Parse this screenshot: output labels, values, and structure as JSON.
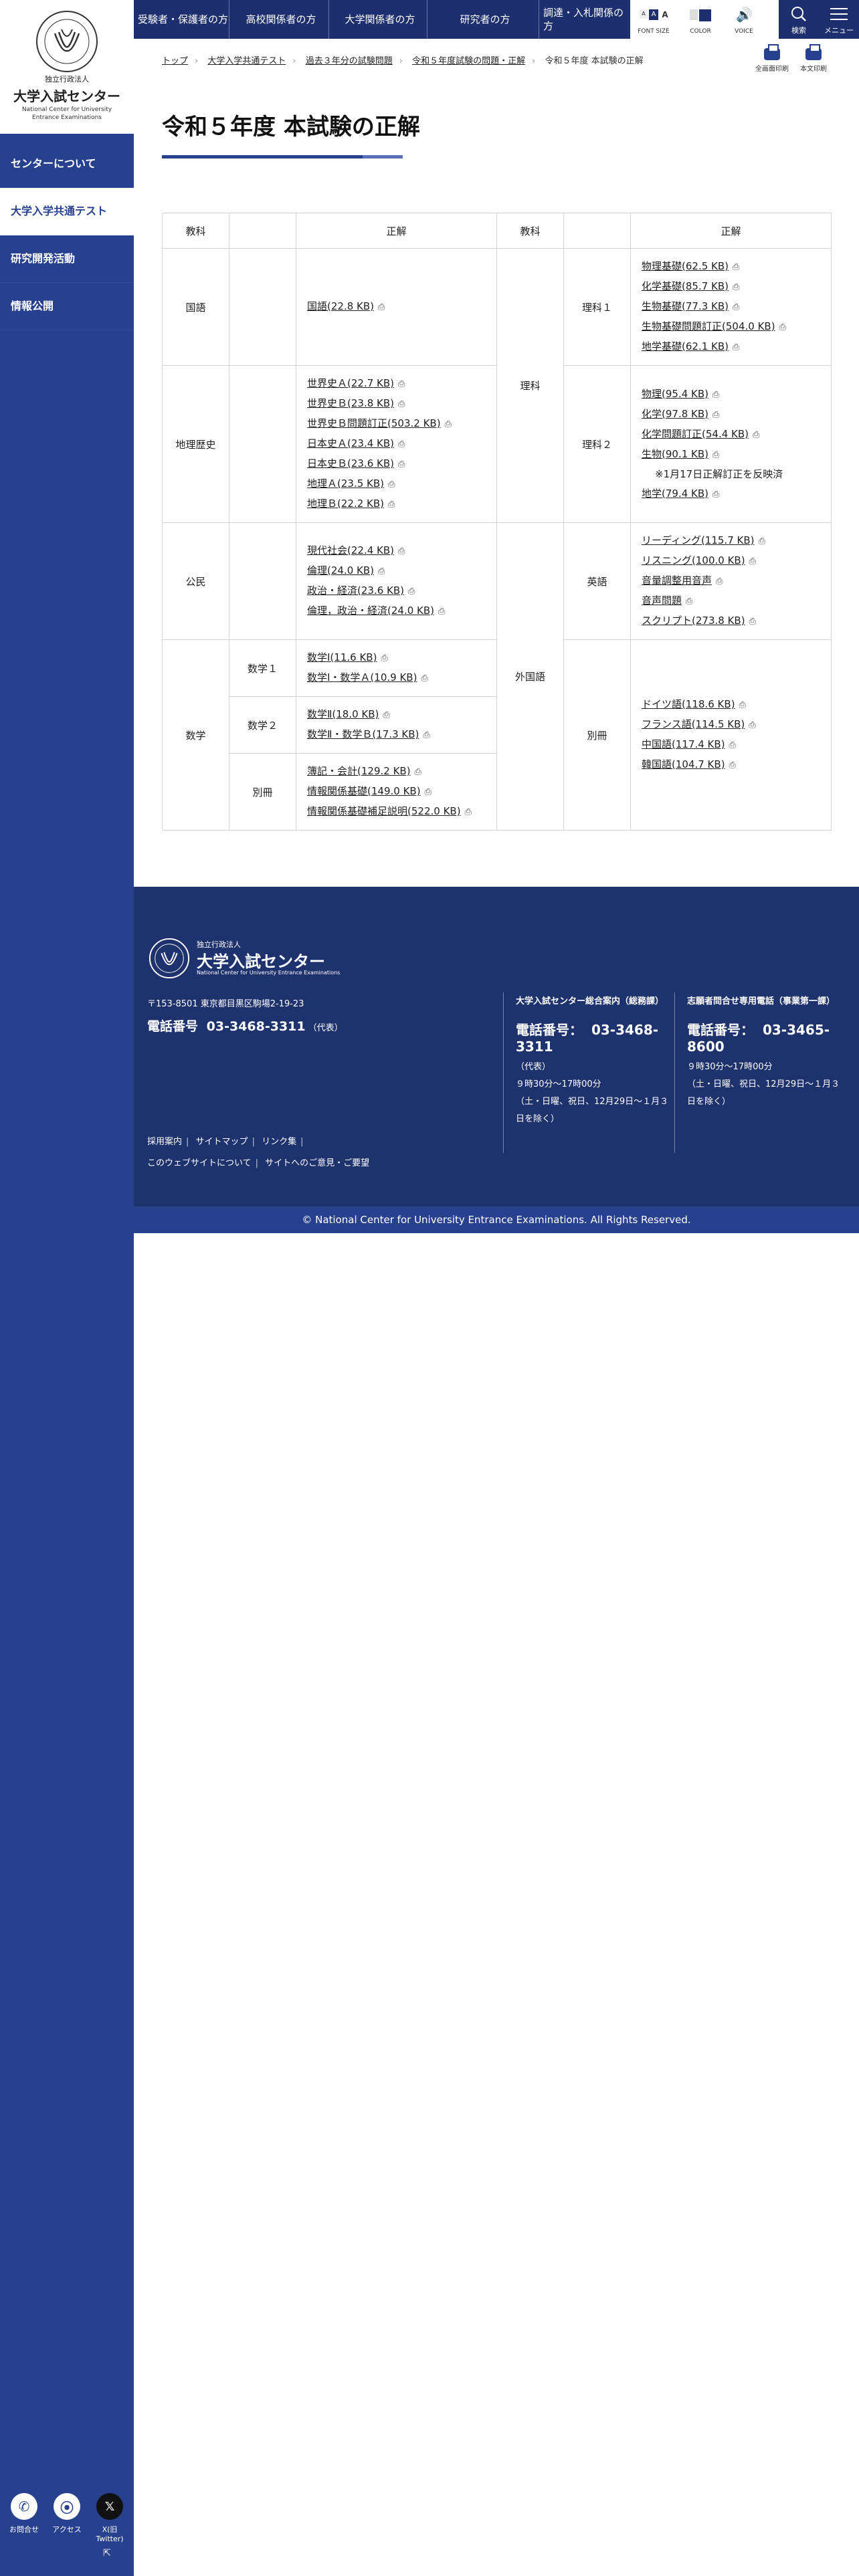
{
  "logo": {
    "corp_type": "独立行政法人",
    "name": "大学入試センター",
    "name_en_line1": "National Center for University",
    "name_en_line2": "Entrance Examinations",
    "seal_text": "NATIONAL CENTER FOR UNIVERSITY ENTRANCE EXAMINATIONS"
  },
  "sidebar": {
    "items": [
      {
        "label": "センターについて"
      },
      {
        "label": "大学入学共通テスト"
      },
      {
        "label": "研究開発活動"
      },
      {
        "label": "情報公開"
      }
    ],
    "bottom": [
      {
        "label": "お問合せ",
        "icon": "phone-icon"
      },
      {
        "label": "アクセス",
        "icon": "map-pin-icon"
      },
      {
        "label": "X(旧Twitter)",
        "icon": "x-logo-icon"
      }
    ]
  },
  "topnav": {
    "items": [
      {
        "label": "受験者・保護者の方"
      },
      {
        "label": "高校関係者の方"
      },
      {
        "label": "大学関係者の方"
      },
      {
        "label": "研究者の方"
      },
      {
        "label": "調達・入札関係の方"
      }
    ],
    "font_size_label": "FONT SIZE",
    "color_label": "COLOR",
    "voice_label": "VOICE",
    "search_label": "検索",
    "menu_label": "メニュー"
  },
  "breadcrumb": [
    {
      "label": "トップ"
    },
    {
      "label": "大学入学共通テスト"
    },
    {
      "label": "過去３年分の試験問題"
    },
    {
      "label": "令和５年度試験の問題・正解"
    },
    {
      "label": "令和５年度 本試験の正解"
    }
  ],
  "print": {
    "full": "全画面印刷",
    "body": "本文印刷"
  },
  "page": {
    "title": "令和５年度 本試験の正解"
  },
  "table": {
    "headers": {
      "subject": "教科",
      "answer": "正解"
    },
    "kokugo": {
      "subject": "国語",
      "links": [
        "国語(22.8 KB)"
      ]
    },
    "chireki": {
      "subject": "地理歴史",
      "links": [
        "世界史Ａ(22.7 KB)",
        "世界史Ｂ(23.8 KB)",
        "世界史Ｂ問題訂正(503.2 KB)",
        "日本史Ａ(23.4 KB)",
        "日本史Ｂ(23.6 KB)",
        "地理Ａ(23.5 KB)",
        "地理Ｂ(22.2 KB)"
      ]
    },
    "komin": {
      "subject": "公民",
      "links": [
        "現代社会(22.4 KB)",
        "倫理(24.0 KB)",
        "政治・経済(23.6 KB)",
        "倫理，政治・経済(24.0 KB)"
      ]
    },
    "sugaku": {
      "subject": "数学",
      "sub1": {
        "label": "数学１",
        "links": [
          "数学Ⅰ(11.6 KB)",
          "数学Ⅰ・数学Ａ(10.9 KB)"
        ]
      },
      "sub2": {
        "label": "数学２",
        "links": [
          "数学Ⅱ(18.0 KB)",
          "数学Ⅱ・数学Ｂ(17.3 KB)"
        ]
      },
      "sub3": {
        "label": "別冊",
        "links": [
          "簿記・会計(129.2 KB)",
          "情報関係基礎(149.0 KB)",
          "情報関係基礎補足説明(522.0 KB)"
        ]
      }
    },
    "rika": {
      "subject": "理科",
      "sub1": {
        "label": "理科１",
        "links": [
          "物理基礎(62.5 KB)",
          "化学基礎(85.7 KB)",
          "生物基礎(77.3 KB)",
          "生物基礎問題訂正(504.0 KB)",
          "地学基礎(62.1 KB)"
        ]
      },
      "sub2": {
        "label": "理科２",
        "links": [
          "物理(95.4 KB)",
          "化学(97.8 KB)",
          "化学問題訂正(54.4 KB)",
          "生物(90.1 KB)"
        ],
        "note": "※1月17日正解訂正を反映済",
        "links_after": [
          "地学(79.4 KB)"
        ]
      }
    },
    "gaikokugo": {
      "subject": "外国語",
      "sub1": {
        "label": "英語",
        "links": [
          "リーディング(115.7 KB)",
          "リスニング(100.0 KB)",
          "音量調整用音声",
          "音声問題",
          "スクリプト(273.8 KB)"
        ]
      },
      "sub2": {
        "label": "別冊",
        "links": [
          "ドイツ語(118.6 KB)",
          "フランス語(114.5 KB)",
          "中国語(117.4 KB)",
          "韓国語(104.7 KB)"
        ]
      }
    }
  },
  "footer": {
    "corp_type": "独立行政法人",
    "name": "大学入試センター",
    "name_en": "National Center for University Entrance Examinations",
    "address": "〒153-8501 東京都目黒区駒場2-19-23",
    "tel_label": "電話番号",
    "tel": "03-3468-3311",
    "tel_note": "（代表）",
    "links": [
      "採用案内",
      "サイトマップ",
      "リンク集",
      "このウェブサイトについて",
      "サイトへのご意見・ご要望"
    ],
    "col1": {
      "title": "大学入試センター総合案内（総務課）",
      "tel_label": "電話番号：",
      "tel": "03-3468-3311",
      "note1": "（代表）",
      "note2": "９時30分〜17時00分",
      "note3": "（土・日曜、祝日、12月29日〜１月３日を除く）"
    },
    "col2": {
      "title": "志願者問合せ専用電話（事業第一課）",
      "tel_label": "電話番号：",
      "tel": "03-3465-8600",
      "note1": "９時30分〜17時00分",
      "note2": "（土・日曜、祝日、12月29日〜１月３日を除く）"
    },
    "copyright": "© National Center for University Entrance Examinations. All Rights Reserved."
  },
  "colors": {
    "primary": "#28418f",
    "nav_dark": "#1d2f6e",
    "footer": "#1e326e"
  }
}
